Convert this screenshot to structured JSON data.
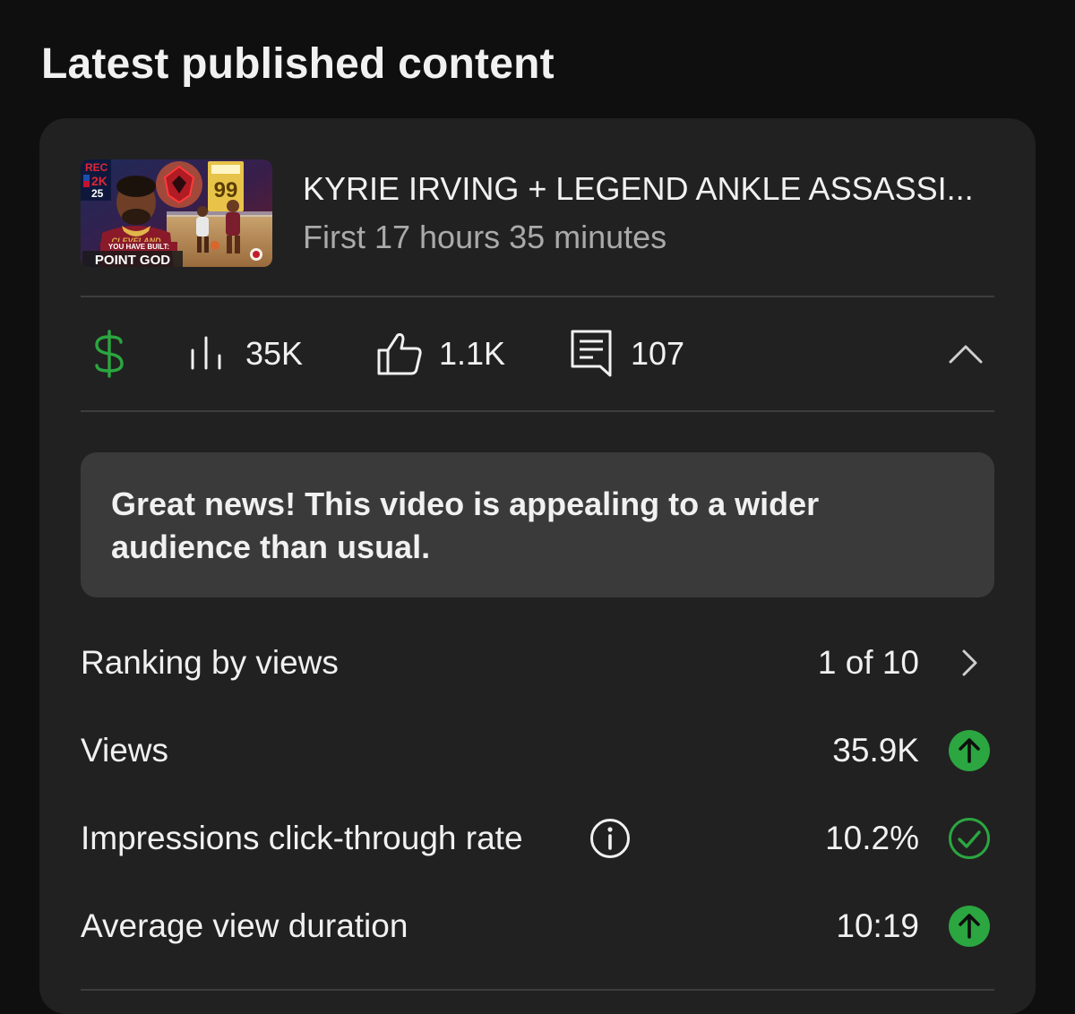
{
  "section": {
    "title": "Latest published content"
  },
  "video": {
    "title": "KYRIE IRVING + LEGEND ANKLE ASSASSI...",
    "subtitle": "First 17 hours 35 minutes",
    "thumbnail": {
      "rec_text": "REC",
      "game_text": "2K",
      "year_text": "25",
      "rating": "99",
      "jersey_text": "CLEVELAND",
      "built_text": "YOU HAVE BUILT:",
      "build_name": "POINT GOD"
    }
  },
  "stats": {
    "monetization_icon": "dollar-icon",
    "views": "35K",
    "likes": "1.1K",
    "comments": "107",
    "colors": {
      "monetization": "#2ba640"
    }
  },
  "banner": {
    "text": "Great news! This video is appealing to a wider audience than usual."
  },
  "metrics": {
    "ranking": {
      "label": "Ranking by views",
      "value": "1 of 10",
      "icon": "chevron-right-icon"
    },
    "views": {
      "label": "Views",
      "value": "35.9K",
      "icon": "arrow-up-circle-icon"
    },
    "ctr": {
      "label": "Impressions click-through rate",
      "value": "10.2%",
      "icon": "check-circle-icon"
    },
    "avd": {
      "label": "Average view duration",
      "value": "10:19",
      "icon": "arrow-up-circle-icon"
    }
  },
  "colors": {
    "positive": "#2ba640",
    "background": "#0f0f0f",
    "card": "#212121",
    "banner": "#3a3a3a",
    "secondary_text": "#aaaaaa"
  }
}
